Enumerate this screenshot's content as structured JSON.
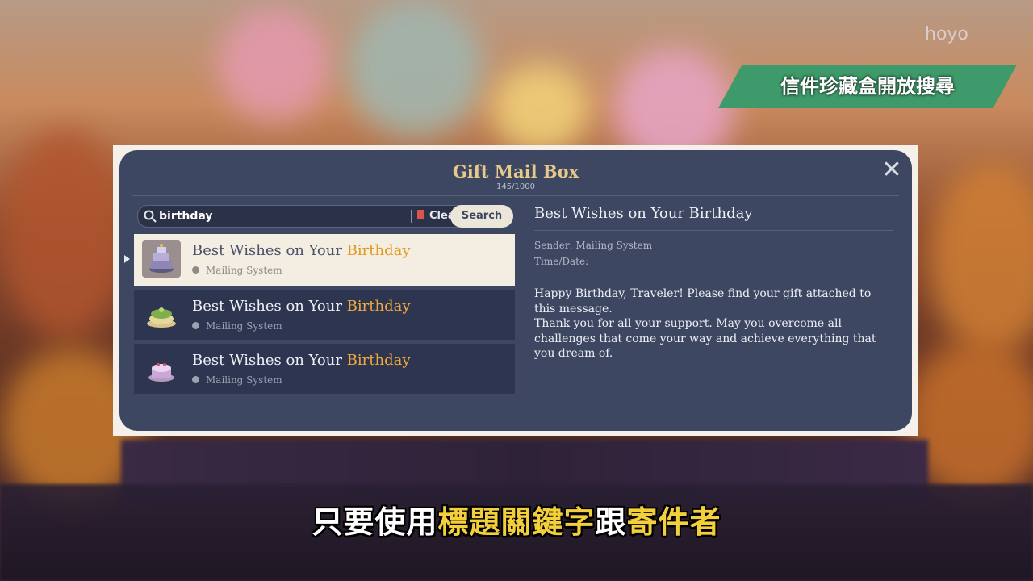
{
  "overlay": {
    "tag": "信件珍藏盒開放搜尋",
    "watermark": "hoyo"
  },
  "dialog": {
    "title": "Gift Mail Box",
    "count": "145/1000",
    "close_icon": "close-icon"
  },
  "search": {
    "value": "birthday",
    "clear_label": "Clear",
    "search_label": "Search"
  },
  "mails": [
    {
      "subject_prefix": "Best Wishes on Your ",
      "subject_highlight": "Birthday",
      "sender": "Mailing System",
      "selected": true,
      "icon": "purple-cake-icon"
    },
    {
      "subject_prefix": "Best Wishes on Your ",
      "subject_highlight": "Birthday",
      "sender": "Mailing System",
      "selected": false,
      "icon": "green-cake-icon"
    },
    {
      "subject_prefix": "Best Wishes on Your ",
      "subject_highlight": "Birthday",
      "sender": "Mailing System",
      "selected": false,
      "icon": "lavender-cake-icon"
    }
  ],
  "detail": {
    "subject": "Best Wishes on Your Birthday",
    "sender": "Sender: Mailing System",
    "time": "Time/Date:",
    "body": [
      "Happy Birthday, Traveler! Please find your gift attached to this message.",
      "Thank you for all your support. May you overcome all challenges that come your way and achieve everything that you dream of."
    ]
  },
  "subtitle": {
    "part1": "只要使用",
    "part2": "標題關鍵字",
    "part3": "跟",
    "part4": "寄件者"
  },
  "colors": {
    "panel": "#3d4762",
    "highlight": "#f0a93b",
    "tag": "#3e9a6b",
    "subtitle_accent": "#f4cf3c"
  }
}
